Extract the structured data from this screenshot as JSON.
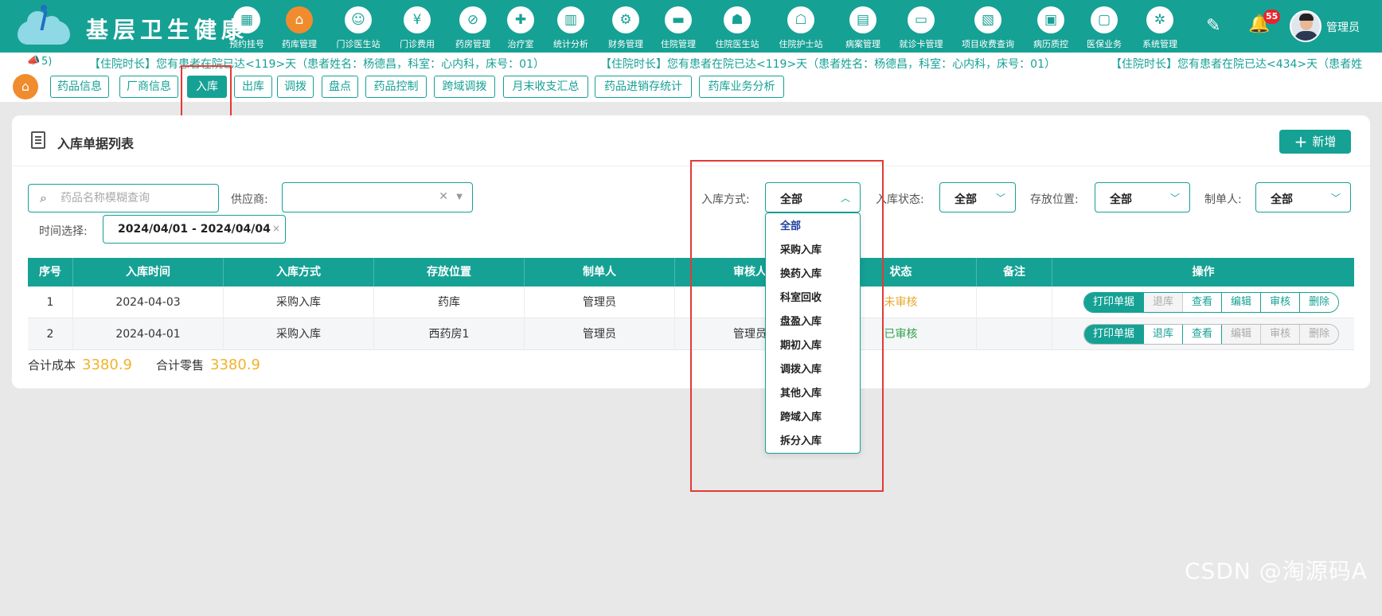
{
  "header": {
    "title": "基层卫生健康",
    "nav": [
      {
        "label": "预约挂号",
        "icon": "calendar-icon",
        "glyph": "▦"
      },
      {
        "label": "药库管理",
        "icon": "pharmacy-warehouse-icon",
        "glyph": "⌂"
      },
      {
        "label": "门诊医生站",
        "icon": "doctor-icon",
        "glyph": "☺"
      },
      {
        "label": "门诊费用",
        "icon": "yen-icon",
        "glyph": "¥"
      },
      {
        "label": "药房管理",
        "icon": "pill-icon",
        "glyph": "⊘"
      },
      {
        "label": "治疗室",
        "icon": "treatment-icon",
        "glyph": "✚"
      },
      {
        "label": "统计分析",
        "icon": "chart-icon",
        "glyph": "▥"
      },
      {
        "label": "财务管理",
        "icon": "finance-gear-icon",
        "glyph": "⚙"
      },
      {
        "label": "住院管理",
        "icon": "bed-icon",
        "glyph": "▬"
      },
      {
        "label": "住院医生站",
        "icon": "inpatient-doctor-icon",
        "glyph": "☗"
      },
      {
        "label": "住院护士站",
        "icon": "nurse-icon",
        "glyph": "☖"
      },
      {
        "label": "病案管理",
        "icon": "medical-record-icon",
        "glyph": "▤"
      },
      {
        "label": "就诊卡管理",
        "icon": "card-icon",
        "glyph": "▭"
      },
      {
        "label": "项目收费查询",
        "icon": "fee-query-icon",
        "glyph": "▧"
      },
      {
        "label": "病历质控",
        "icon": "quality-control-icon",
        "glyph": "▣"
      },
      {
        "label": "医保业务",
        "icon": "insurance-icon",
        "glyph": "▢"
      },
      {
        "label": "系统管理",
        "icon": "settings-icon",
        "glyph": "✲"
      }
    ],
    "notification_count": "55",
    "user_name": "管理员"
  },
  "marquee": {
    "prefix": "5)",
    "messages": [
      "【住院时长】您有患者在院已达<119>天（患者姓名：杨德昌，科室：心内科，床号：01）",
      "【住院时长】您有患者在院已达<119>天（患者姓名：杨德昌，科室：心内科，床号：01）",
      "【住院时长】您有患者在院已达<434>天（患者姓"
    ]
  },
  "tabs": [
    "药品信息",
    "厂商信息",
    "入库",
    "出库",
    "调拨",
    "盘点",
    "药品控制",
    "跨域调拨",
    "月末收支汇总",
    "药品进销存统计",
    "药库业务分析"
  ],
  "active_tab": "入库",
  "card": {
    "title": "入库单据列表",
    "add_label": "新增",
    "search_placeholder": "药品名称模糊查询",
    "filters": {
      "supplier_label": "供应商:",
      "supplier_value": "",
      "method_label": "入库方式:",
      "method_value": "全部",
      "status_label": "入库状态:",
      "status_value": "全部",
      "location_label": "存放位置:",
      "location_value": "全部",
      "creator_label": "制单人:",
      "creator_value": "全部",
      "time_label": "时间选择:",
      "time_value": "2024/04/01 - 2024/04/04"
    },
    "table": {
      "columns": [
        "序号",
        "入库时间",
        "入库方式",
        "存放位置",
        "制单人",
        "审核人",
        "状态",
        "备注",
        "操作"
      ],
      "rows": [
        {
          "no": "1",
          "time": "2024-04-03",
          "method": "采购入库",
          "location": "药库",
          "creator": "管理员",
          "auditor": "",
          "status": "未审核",
          "remark": "",
          "ops": [
            "打印单据",
            "退库",
            "查看",
            "编辑",
            "审核",
            "删除"
          ]
        },
        {
          "no": "2",
          "time": "2024-04-01",
          "method": "采购入库",
          "location": "西药房1",
          "creator": "管理员",
          "auditor": "管理员",
          "status": "已审核",
          "remark": "",
          "ops": [
            "打印单据",
            "退库",
            "查看",
            "编辑",
            "审核",
            "删除"
          ]
        }
      ]
    },
    "totals": {
      "cost_label": "合计成本",
      "cost_value": "3380.9",
      "retail_label": "合计零售",
      "retail_value": "3380.9"
    }
  },
  "method_dropdown": {
    "options": [
      "全部",
      "采购入库",
      "换药入库",
      "科室回收",
      "盘盈入库",
      "期初入库",
      "调拨入库",
      "其他入库",
      "跨域入库",
      "拆分入库"
    ],
    "selected": "全部"
  },
  "watermark": "CSDN @淘源码A",
  "colors": {
    "primary": "#16a195",
    "accent_orange": "#f08c2e",
    "highlight_red": "#e53935",
    "pending": "#e5a82e",
    "approved": "#32a14b",
    "total": "#f0b32a"
  }
}
